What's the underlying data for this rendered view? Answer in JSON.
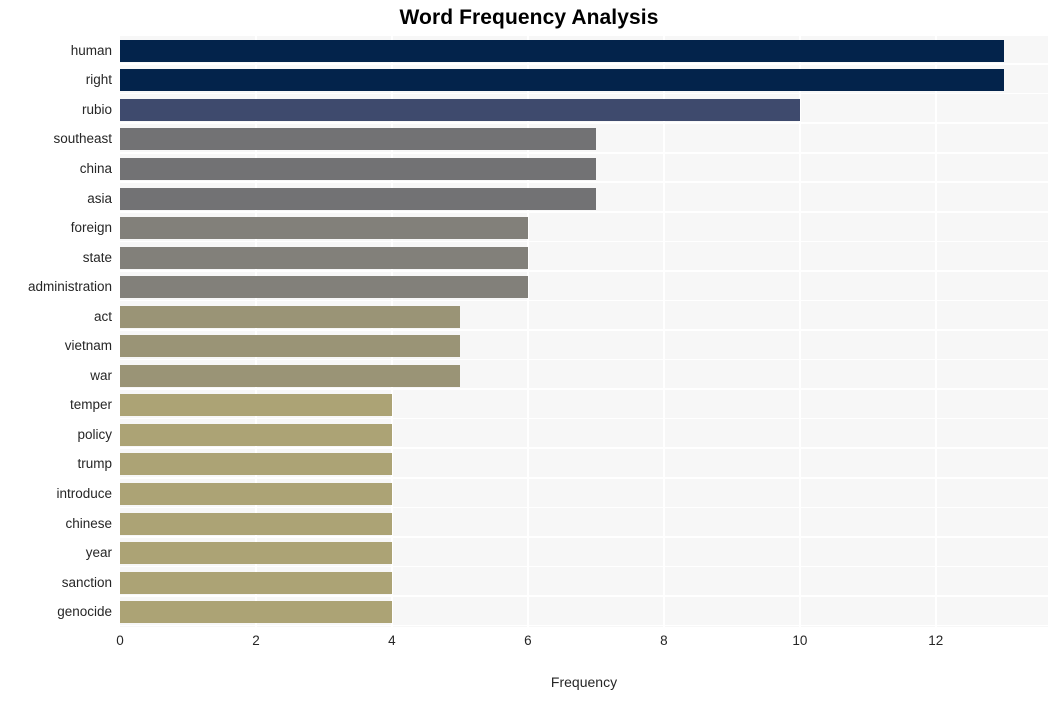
{
  "chart_data": {
    "type": "bar",
    "orientation": "horizontal",
    "title": "Word Frequency Analysis",
    "xlabel": "Frequency",
    "ylabel": "",
    "categories": [
      "human",
      "right",
      "rubio",
      "southeast",
      "china",
      "asia",
      "foreign",
      "state",
      "administration",
      "act",
      "vietnam",
      "war",
      "temper",
      "policy",
      "trump",
      "introduce",
      "chinese",
      "year",
      "sanction",
      "genocide"
    ],
    "values": [
      13,
      13,
      10,
      7,
      7,
      7,
      6,
      6,
      6,
      5,
      5,
      5,
      4,
      4,
      4,
      4,
      4,
      4,
      4,
      4
    ],
    "bar_colors": [
      "#03234b",
      "#03234b",
      "#3e4a6d",
      "#727274",
      "#727274",
      "#727274",
      "#82807a",
      "#82807a",
      "#82807a",
      "#9a9476",
      "#9a9476",
      "#9a9476",
      "#aca375",
      "#aca375",
      "#aca375",
      "#aca375",
      "#aca375",
      "#aca375",
      "#aca375",
      "#aca375"
    ],
    "xlim": [
      0,
      13.65
    ],
    "xticks": [
      0,
      2,
      4,
      6,
      8,
      10,
      12
    ],
    "xtick_labels": [
      "0",
      "2",
      "4",
      "6",
      "8",
      "10",
      "12"
    ],
    "grid": true,
    "grid_color": "#ffffff",
    "plot_background": "#f7f7f7",
    "figure_background": "#ffffff",
    "legend": null,
    "legend_position": "none"
  }
}
